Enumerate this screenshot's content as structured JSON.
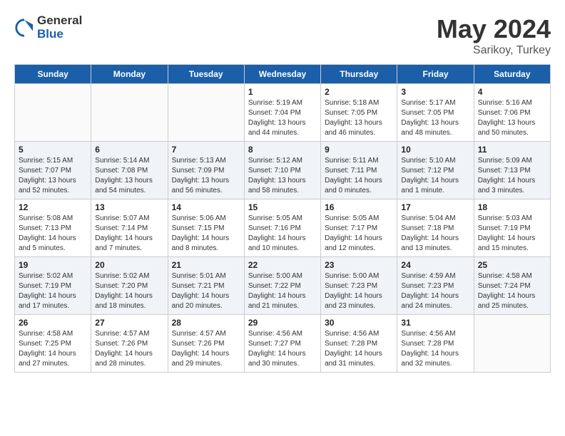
{
  "header": {
    "logo_general": "General",
    "logo_blue": "Blue",
    "month": "May 2024",
    "location": "Sarikoy, Turkey"
  },
  "weekdays": [
    "Sunday",
    "Monday",
    "Tuesday",
    "Wednesday",
    "Thursday",
    "Friday",
    "Saturday"
  ],
  "weeks": [
    [
      {
        "day": "",
        "empty": true
      },
      {
        "day": "",
        "empty": true
      },
      {
        "day": "",
        "empty": true
      },
      {
        "day": "1",
        "info": "Sunrise: 5:19 AM\nSunset: 7:04 PM\nDaylight: 13 hours\nand 44 minutes."
      },
      {
        "day": "2",
        "info": "Sunrise: 5:18 AM\nSunset: 7:05 PM\nDaylight: 13 hours\nand 46 minutes."
      },
      {
        "day": "3",
        "info": "Sunrise: 5:17 AM\nSunset: 7:05 PM\nDaylight: 13 hours\nand 48 minutes."
      },
      {
        "day": "4",
        "info": "Sunrise: 5:16 AM\nSunset: 7:06 PM\nDaylight: 13 hours\nand 50 minutes."
      }
    ],
    [
      {
        "day": "5",
        "info": "Sunrise: 5:15 AM\nSunset: 7:07 PM\nDaylight: 13 hours\nand 52 minutes."
      },
      {
        "day": "6",
        "info": "Sunrise: 5:14 AM\nSunset: 7:08 PM\nDaylight: 13 hours\nand 54 minutes."
      },
      {
        "day": "7",
        "info": "Sunrise: 5:13 AM\nSunset: 7:09 PM\nDaylight: 13 hours\nand 56 minutes."
      },
      {
        "day": "8",
        "info": "Sunrise: 5:12 AM\nSunset: 7:10 PM\nDaylight: 13 hours\nand 58 minutes."
      },
      {
        "day": "9",
        "info": "Sunrise: 5:11 AM\nSunset: 7:11 PM\nDaylight: 14 hours\nand 0 minutes."
      },
      {
        "day": "10",
        "info": "Sunrise: 5:10 AM\nSunset: 7:12 PM\nDaylight: 14 hours\nand 1 minute."
      },
      {
        "day": "11",
        "info": "Sunrise: 5:09 AM\nSunset: 7:13 PM\nDaylight: 14 hours\nand 3 minutes."
      }
    ],
    [
      {
        "day": "12",
        "info": "Sunrise: 5:08 AM\nSunset: 7:13 PM\nDaylight: 14 hours\nand 5 minutes."
      },
      {
        "day": "13",
        "info": "Sunrise: 5:07 AM\nSunset: 7:14 PM\nDaylight: 14 hours\nand 7 minutes."
      },
      {
        "day": "14",
        "info": "Sunrise: 5:06 AM\nSunset: 7:15 PM\nDaylight: 14 hours\nand 8 minutes."
      },
      {
        "day": "15",
        "info": "Sunrise: 5:05 AM\nSunset: 7:16 PM\nDaylight: 14 hours\nand 10 minutes."
      },
      {
        "day": "16",
        "info": "Sunrise: 5:05 AM\nSunset: 7:17 PM\nDaylight: 14 hours\nand 12 minutes."
      },
      {
        "day": "17",
        "info": "Sunrise: 5:04 AM\nSunset: 7:18 PM\nDaylight: 14 hours\nand 13 minutes."
      },
      {
        "day": "18",
        "info": "Sunrise: 5:03 AM\nSunset: 7:19 PM\nDaylight: 14 hours\nand 15 minutes."
      }
    ],
    [
      {
        "day": "19",
        "info": "Sunrise: 5:02 AM\nSunset: 7:19 PM\nDaylight: 14 hours\nand 17 minutes."
      },
      {
        "day": "20",
        "info": "Sunrise: 5:02 AM\nSunset: 7:20 PM\nDaylight: 14 hours\nand 18 minutes."
      },
      {
        "day": "21",
        "info": "Sunrise: 5:01 AM\nSunset: 7:21 PM\nDaylight: 14 hours\nand 20 minutes."
      },
      {
        "day": "22",
        "info": "Sunrise: 5:00 AM\nSunset: 7:22 PM\nDaylight: 14 hours\nand 21 minutes."
      },
      {
        "day": "23",
        "info": "Sunrise: 5:00 AM\nSunset: 7:23 PM\nDaylight: 14 hours\nand 23 minutes."
      },
      {
        "day": "24",
        "info": "Sunrise: 4:59 AM\nSunset: 7:23 PM\nDaylight: 14 hours\nand 24 minutes."
      },
      {
        "day": "25",
        "info": "Sunrise: 4:58 AM\nSunset: 7:24 PM\nDaylight: 14 hours\nand 25 minutes."
      }
    ],
    [
      {
        "day": "26",
        "info": "Sunrise: 4:58 AM\nSunset: 7:25 PM\nDaylight: 14 hours\nand 27 minutes."
      },
      {
        "day": "27",
        "info": "Sunrise: 4:57 AM\nSunset: 7:26 PM\nDaylight: 14 hours\nand 28 minutes."
      },
      {
        "day": "28",
        "info": "Sunrise: 4:57 AM\nSunset: 7:26 PM\nDaylight: 14 hours\nand 29 minutes."
      },
      {
        "day": "29",
        "info": "Sunrise: 4:56 AM\nSunset: 7:27 PM\nDaylight: 14 hours\nand 30 minutes."
      },
      {
        "day": "30",
        "info": "Sunrise: 4:56 AM\nSunset: 7:28 PM\nDaylight: 14 hours\nand 31 minutes."
      },
      {
        "day": "31",
        "info": "Sunrise: 4:56 AM\nSunset: 7:28 PM\nDaylight: 14 hours\nand 32 minutes."
      },
      {
        "day": "",
        "empty": true
      }
    ]
  ]
}
